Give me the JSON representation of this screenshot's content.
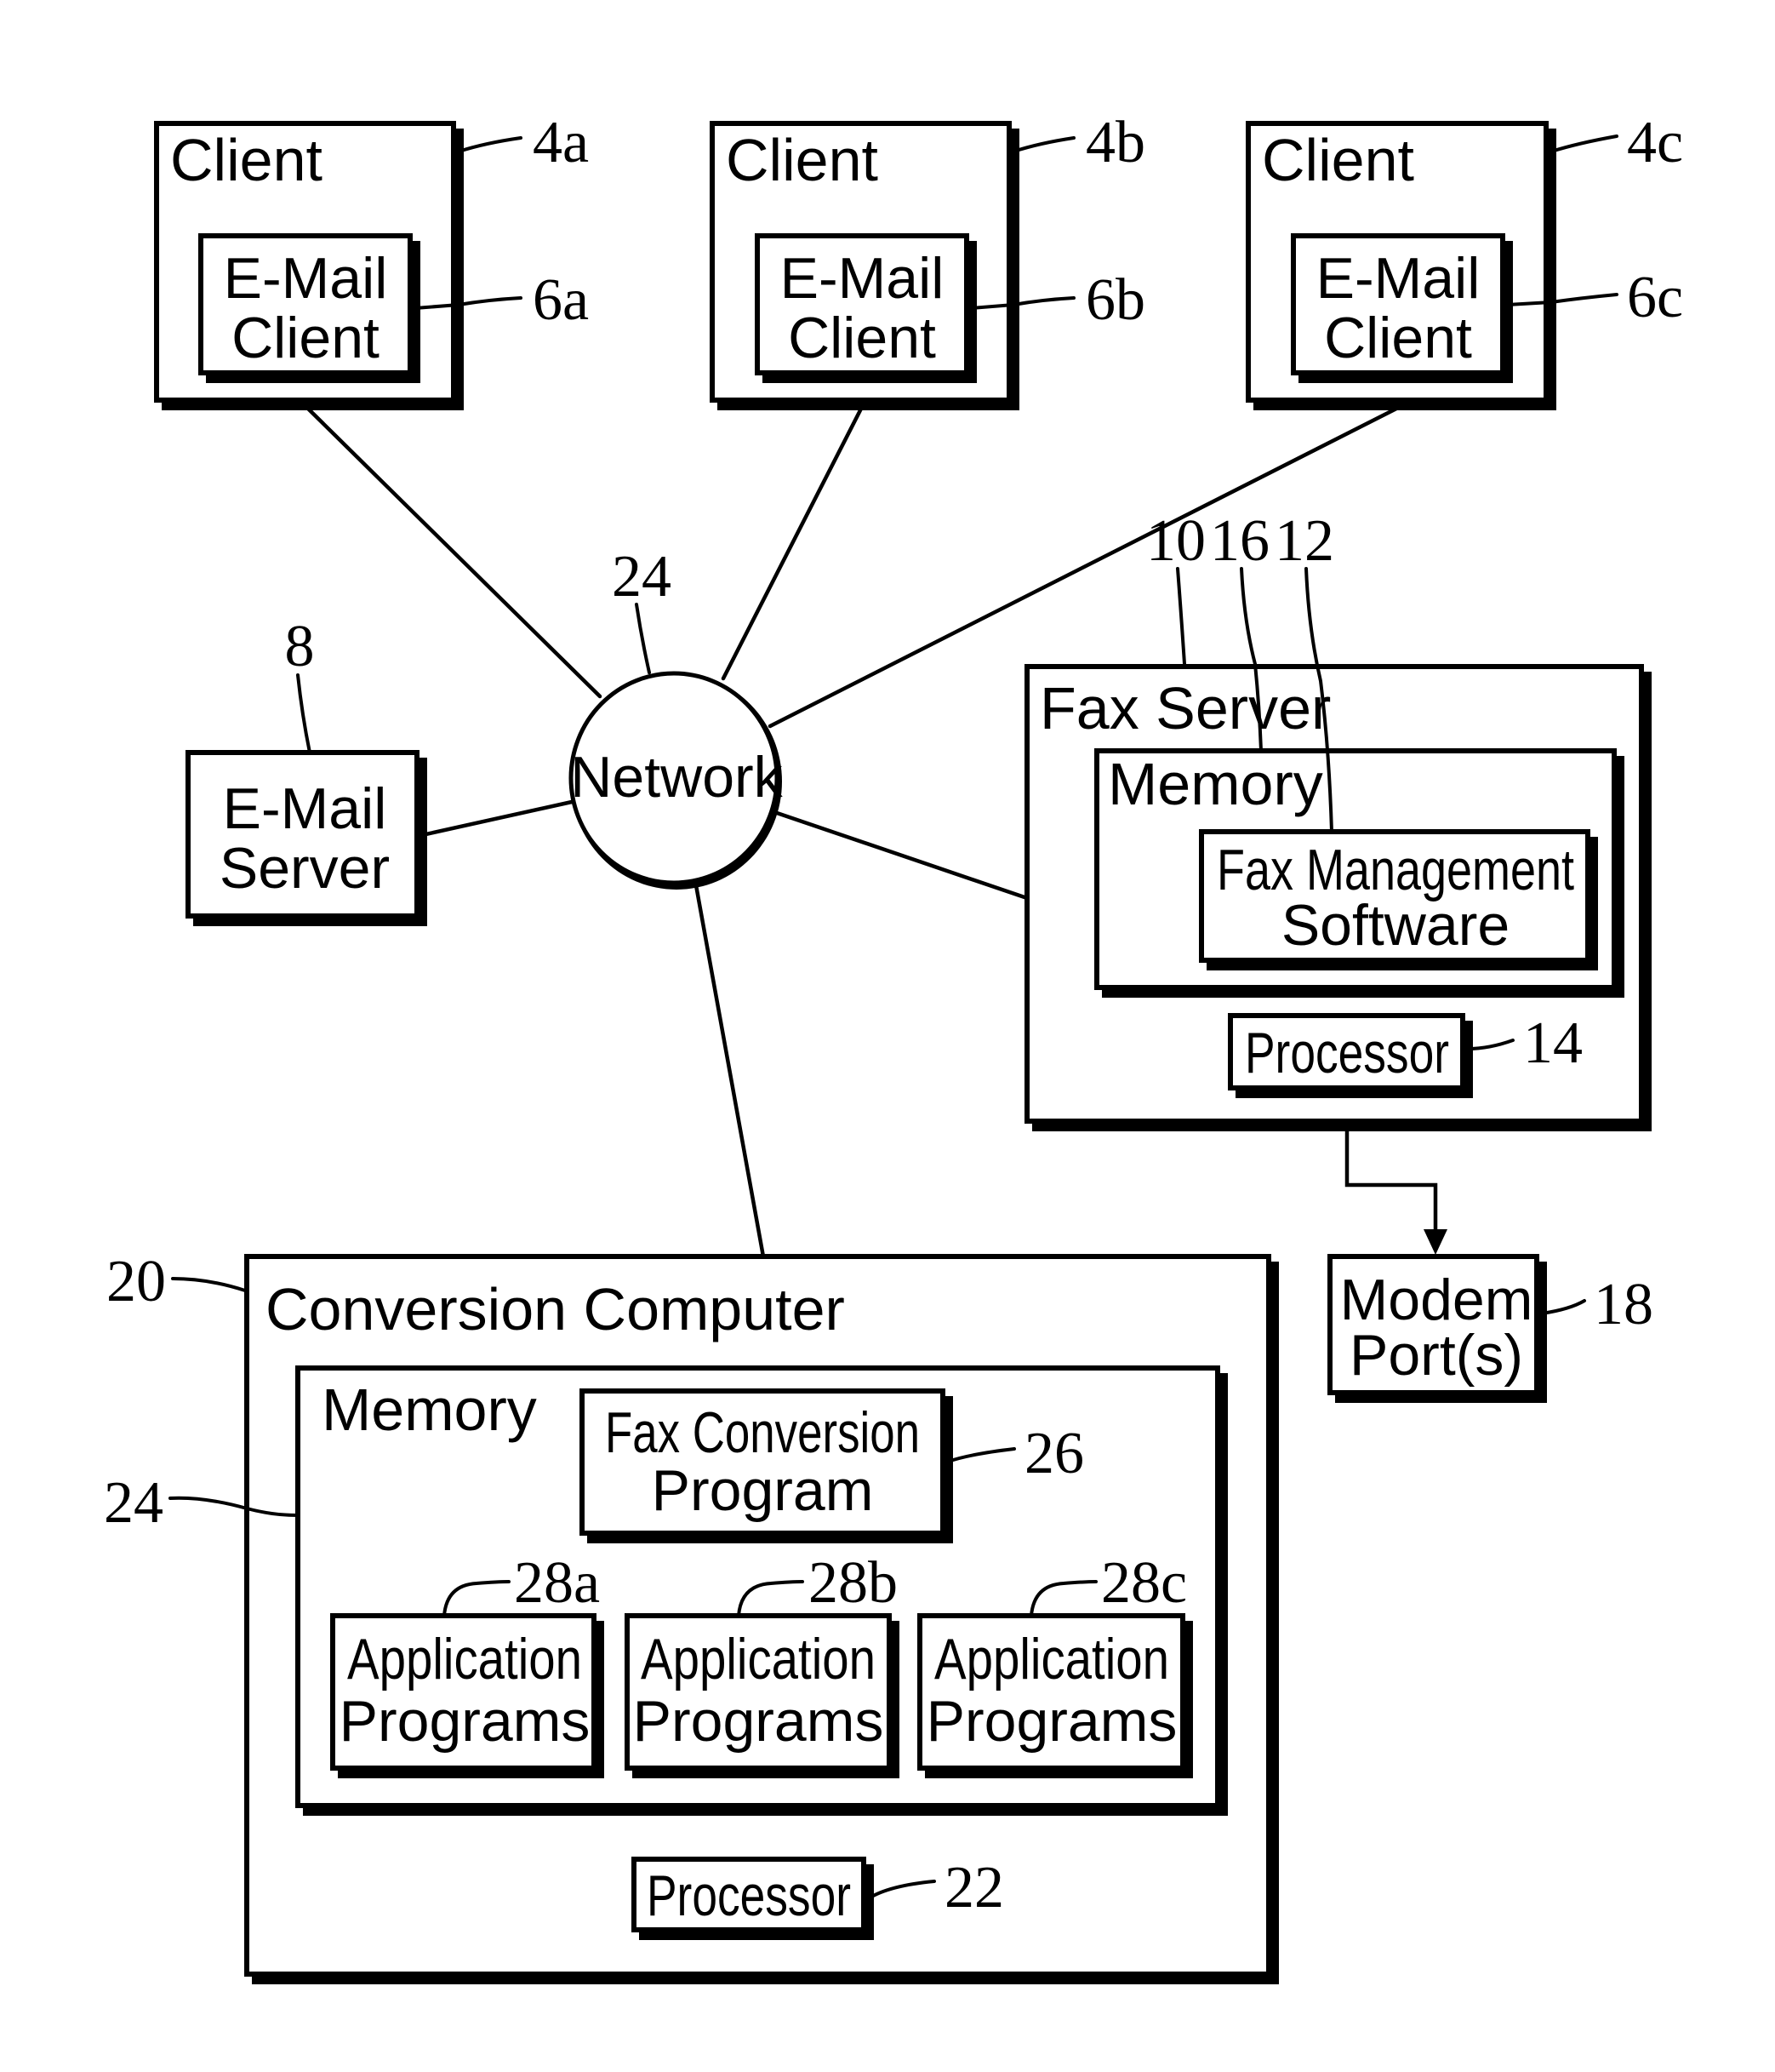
{
  "diagram": {
    "colors": {
      "ink": "#000000",
      "background": "#ffffff"
    },
    "clients": [
      {
        "title": "Client",
        "ref": "4a",
        "email_client": {
          "line1": "E-Mail",
          "line2": "Client",
          "ref": "6a"
        }
      },
      {
        "title": "Client",
        "ref": "4b",
        "email_client": {
          "line1": "E-Mail",
          "line2": "Client",
          "ref": "6b"
        }
      },
      {
        "title": "Client",
        "ref": "4c",
        "email_client": {
          "line1": "E-Mail",
          "line2": "Client",
          "ref": "6c"
        }
      }
    ],
    "network": {
      "label": "Network",
      "ref": "24"
    },
    "email_server": {
      "line1": "E-Mail",
      "line2": "Server",
      "ref": "8"
    },
    "fax_server": {
      "title": "Fax Server",
      "ref": "10",
      "memory": {
        "label": "Memory",
        "ref": "16"
      },
      "fax_management_software": {
        "line1": "Fax Management",
        "line2": "Software",
        "ref": "12"
      },
      "processor": {
        "label": "Processor",
        "ref": "14"
      }
    },
    "modem_ports": {
      "line1": "Modem",
      "line2": "Port(s)",
      "ref": "18"
    },
    "conversion_computer": {
      "title": "Conversion Computer",
      "ref": "20",
      "memory": {
        "label": "Memory",
        "ref": "24"
      },
      "fax_conversion_program": {
        "line1": "Fax Conversion",
        "line2": "Program",
        "ref": "26"
      },
      "application_programs": [
        {
          "line1": "Application",
          "line2": "Programs",
          "ref": "28a"
        },
        {
          "line1": "Application",
          "line2": "Programs",
          "ref": "28b"
        },
        {
          "line1": "Application",
          "line2": "Programs",
          "ref": "28c"
        }
      ],
      "processor": {
        "label": "Processor",
        "ref": "22"
      }
    }
  }
}
